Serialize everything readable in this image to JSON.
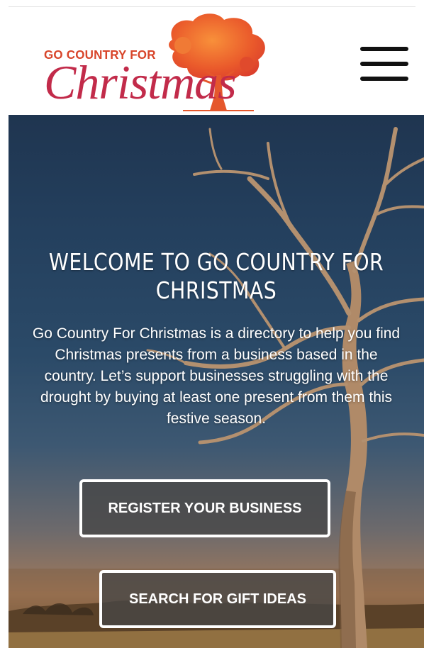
{
  "header": {
    "logo_small_text": "GO COUNTRY FOR",
    "logo_script_text": "Christmas",
    "menu_icon": "hamburger-menu-icon"
  },
  "hero": {
    "title": "WELCOME TO GO COUNTRY FOR CHRISTMAS",
    "description": "Go Country For Christmas is a directory to help you find Christmas presents from a business based in the country. Let’s support businesses struggling with the drought by buying at least one present from them this festive season.",
    "buttons": [
      {
        "label": "REGISTER YOUR BUSINESS"
      },
      {
        "label": "SEARCH FOR GIFT IDEAS"
      }
    ]
  },
  "colors": {
    "logo_orange": "#d8452a",
    "logo_red": "#c22b4a",
    "tree_orange": "#ef6a2d",
    "sky_top": "#1f3550",
    "button_fill": "#464646"
  }
}
